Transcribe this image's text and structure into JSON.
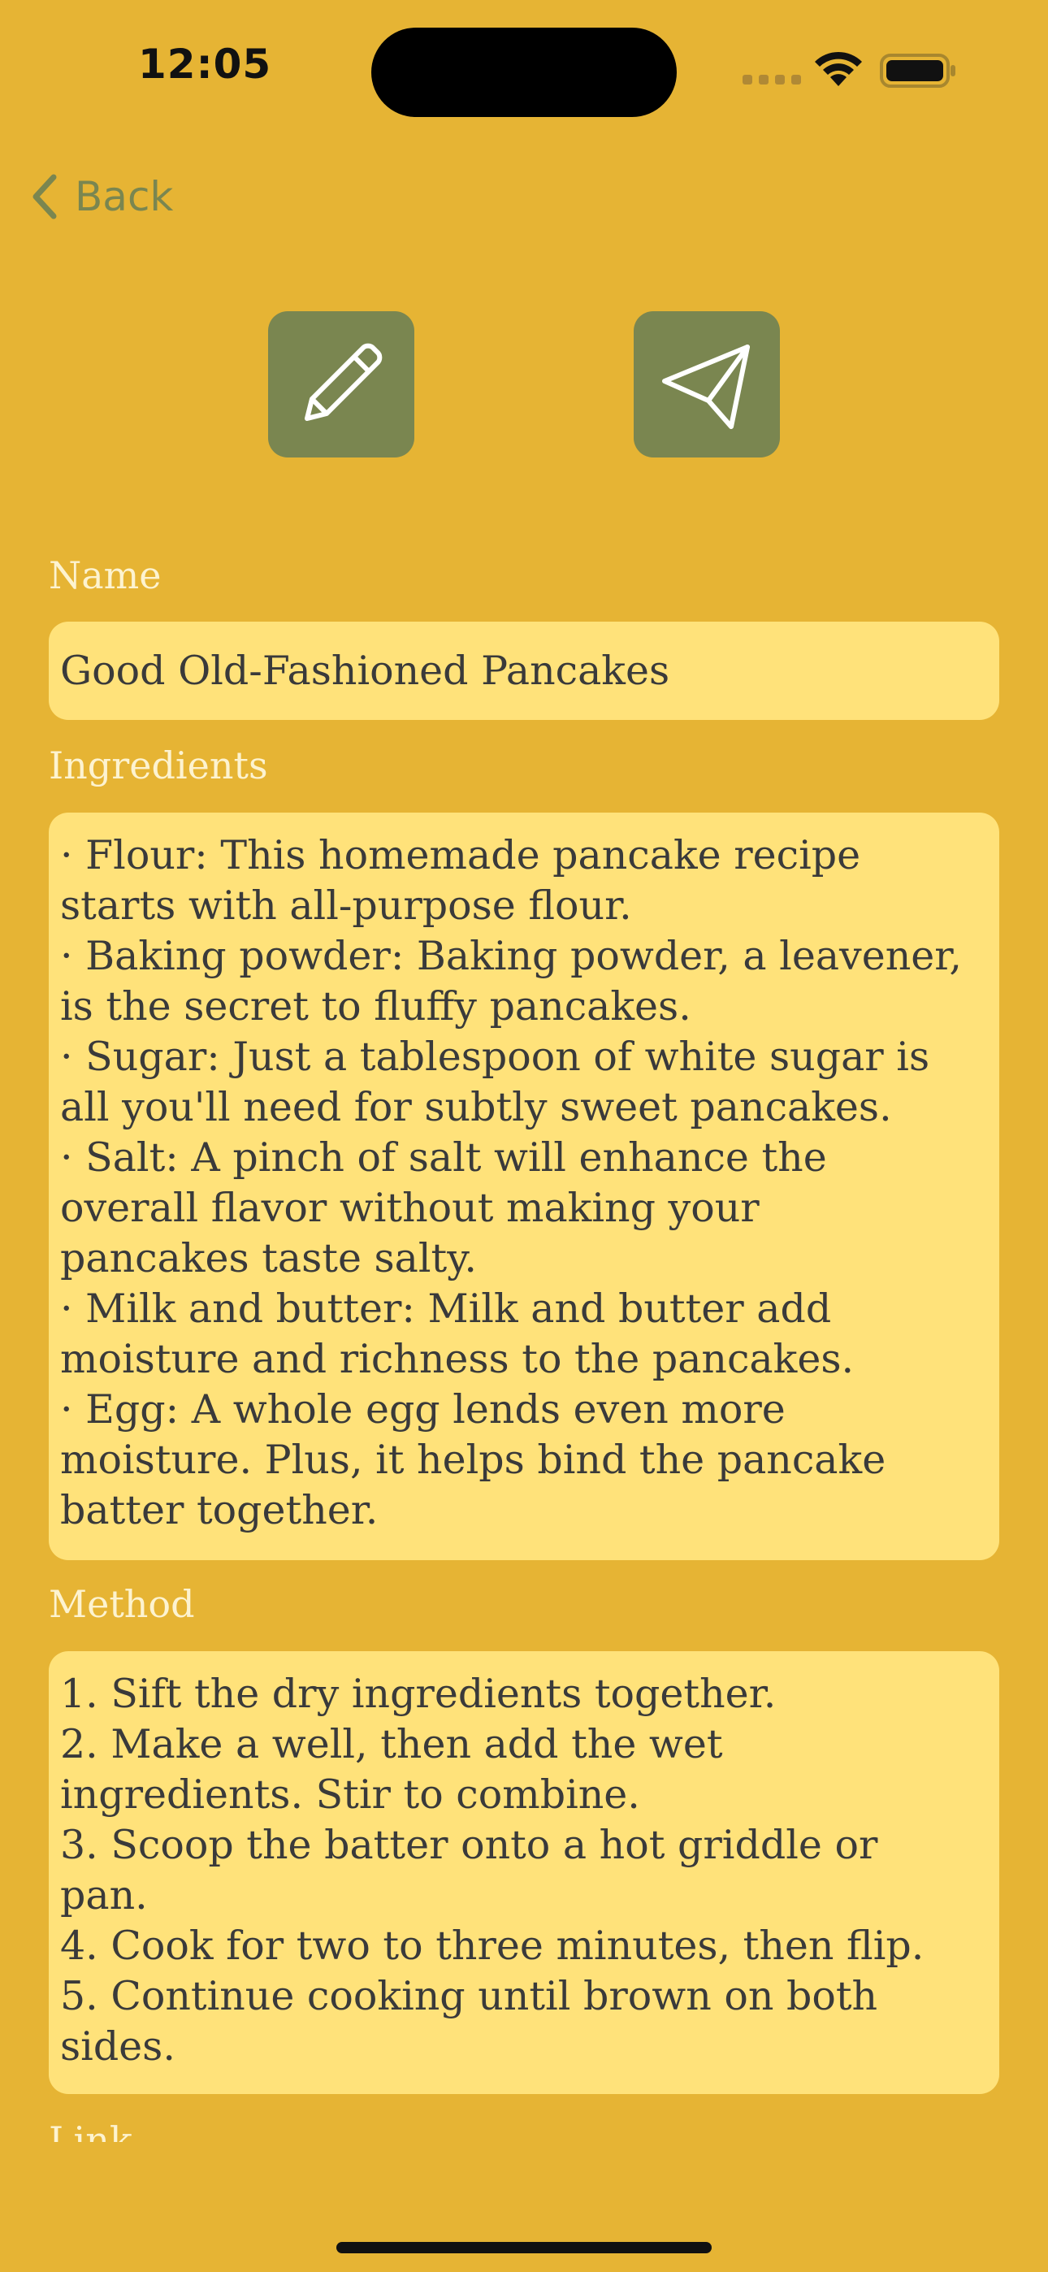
{
  "status_bar": {
    "time": "12:05"
  },
  "nav": {
    "back_label": "Back"
  },
  "actions": {
    "edit_icon": "pencil-icon",
    "send_icon": "paper-plane-icon"
  },
  "form": {
    "name_label": "Name",
    "name_value": "Good Old-Fashioned Pancakes",
    "ingredients_label": "Ingredients",
    "ingredients_lines": [
      "· Flour: This homemade pancake recipe",
      "starts with all-purpose flour.",
      "· Baking powder: Baking powder, a leavener,",
      "is the secret to fluffy pancakes.",
      "· Sugar: Just a tablespoon of white sugar is",
      "all you'll need for subtly sweet pancakes.",
      "· Salt: A pinch of salt will enhance the",
      "overall flavor without making your",
      "pancakes taste salty.",
      "· Milk and butter: Milk and butter add",
      "moisture and richness to the pancakes.",
      "· Egg: A whole egg lends even more",
      "moisture. Plus, it helps bind the pancake",
      "batter together."
    ],
    "method_label": "Method",
    "method_lines": [
      "1. Sift the dry ingredients together.",
      "2. Make a well, then add the wet",
      "ingredients. Stir to combine.",
      "3. Scoop the batter onto a hot griddle or",
      "pan.",
      "4. Cook for two to three minutes, then flip.",
      "5. Continue cooking until brown on both",
      "sides."
    ],
    "link_label": "Link"
  },
  "colors": {
    "background": "#E6B434",
    "field_background": "#FFE27A",
    "accent": "#7A8650",
    "label_text": "#FDF3D0",
    "field_text": "#3A3A3A"
  }
}
